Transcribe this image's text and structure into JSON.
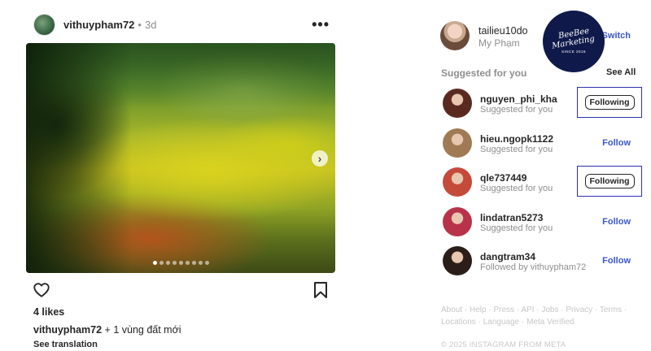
{
  "post": {
    "username": "vithuypham72",
    "separator": "•",
    "time": "3d",
    "more_icon": "more-horizontal-icon",
    "carousel": {
      "total": 9,
      "active": 1
    },
    "likes": "4 likes",
    "caption_user": "vithuypham72",
    "caption_text": "+ 1 vùng đất mới",
    "see_translation": "See translation"
  },
  "me": {
    "username": "tailieu10do",
    "name": "My Phạm",
    "switch_label": "Switch"
  },
  "brand_badge": {
    "line1": "BeeBee",
    "line2": "Marketing",
    "since": "SINCE 2016",
    "color": "#0f1a4a"
  },
  "suggestions": {
    "title": "Suggested for you",
    "see_all": "See All",
    "items": [
      {
        "username": "nguyen_phi_kha",
        "subtitle": "Suggested for you",
        "action": "Following",
        "highlighted": true,
        "avatar_color": "#5a2a20"
      },
      {
        "username": "hieu.ngopk1122",
        "subtitle": "Suggested for you",
        "action": "Follow",
        "highlighted": false,
        "avatar_color": "#a07a55"
      },
      {
        "username": "qle737449",
        "subtitle": "Suggested for you",
        "action": "Following",
        "highlighted": true,
        "avatar_color": "#c44a3a"
      },
      {
        "username": "lindatran5273",
        "subtitle": "Suggested for you",
        "action": "Follow",
        "highlighted": false,
        "avatar_color": "#b8334a"
      },
      {
        "username": "dangtram34",
        "subtitle": "Followed by vithuypham72",
        "action": "Follow",
        "highlighted": false,
        "avatar_color": "#2b1e1a"
      }
    ]
  },
  "footer": {
    "links_line1": "About · Help · Press · API · Jobs · Privacy · Terms ·",
    "links_line2": "Locations · Language · Meta Verified",
    "copyright": "© 2025 INSTAGRAM FROM META"
  },
  "colors": {
    "link_blue": "#3a57c9",
    "highlight_box": "#2d2fb0",
    "muted_text": "#8e8e8e"
  }
}
